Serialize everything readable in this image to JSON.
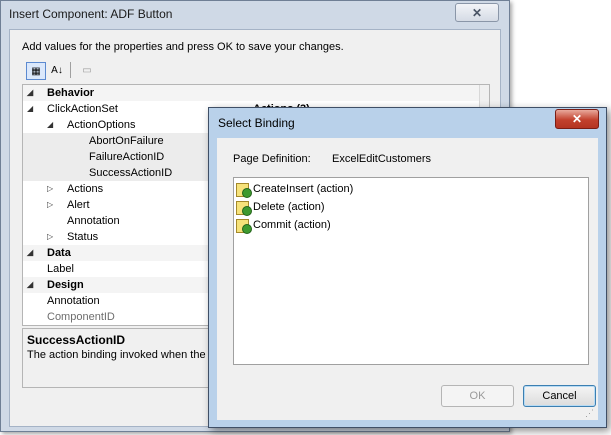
{
  "back_window": {
    "title": "Insert Component: ADF Button",
    "close_glyph": "✕",
    "instructions": "Add values for the properties and press OK to save your changes.",
    "toolbar": {
      "categorize_glyph": "▦",
      "sort_glyph": "A↓",
      "pages_glyph": "▭"
    },
    "grid_rows": [
      {
        "label": "Behavior",
        "kind": "category",
        "twisty": "◢"
      },
      {
        "label": "ClickActionSet",
        "kind": "prop",
        "twisty": "◢",
        "value": "Actions (3)"
      },
      {
        "label": "ActionOptions",
        "kind": "prop",
        "twisty": "◢"
      },
      {
        "label": "AbortOnFailure",
        "kind": "prop"
      },
      {
        "label": "FailureActionID",
        "kind": "prop"
      },
      {
        "label": "SuccessActionID",
        "kind": "prop"
      },
      {
        "label": "Actions",
        "kind": "prop",
        "twisty": "▷"
      },
      {
        "label": "Alert",
        "kind": "prop",
        "twisty": "▷"
      },
      {
        "label": "Annotation",
        "kind": "prop"
      },
      {
        "label": "Status",
        "kind": "prop",
        "twisty": "▷"
      },
      {
        "label": "Data",
        "kind": "category",
        "twisty": "◢"
      },
      {
        "label": "Label",
        "kind": "prop"
      },
      {
        "label": "Design",
        "kind": "category",
        "twisty": "◢"
      },
      {
        "label": "Annotation",
        "kind": "prop"
      },
      {
        "label": "ComponentID",
        "kind": "prop"
      }
    ],
    "description": {
      "title": "SuccessActionID",
      "text": "The action binding invoked when the"
    }
  },
  "dialog": {
    "title": "Select Binding",
    "close_glyph": "✕",
    "page_definition_label": "Page Definition:",
    "page_definition_value": "ExcelEditCustomers",
    "bindings": [
      {
        "label": "CreateInsert (action)",
        "icon": "action-binding-icon"
      },
      {
        "label": "Delete (action)",
        "icon": "action-binding-icon"
      },
      {
        "label": "Commit (action)",
        "icon": "action-binding-icon"
      }
    ],
    "ok_label": "OK",
    "cancel_label": "Cancel",
    "grip_glyph": "⋰"
  }
}
